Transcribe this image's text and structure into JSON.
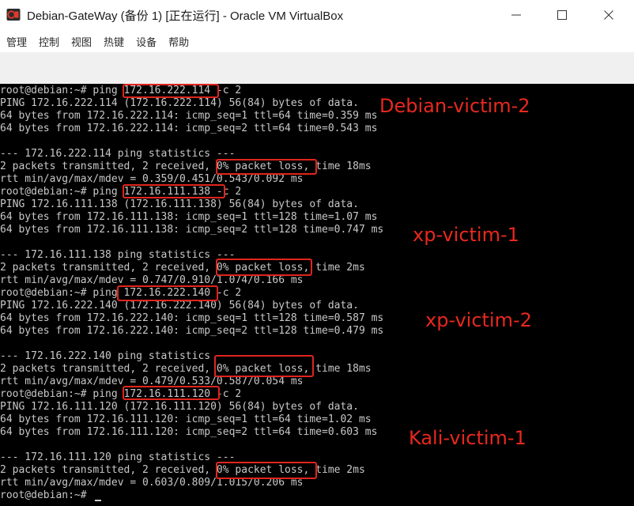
{
  "window": {
    "title": "Debian-GateWay (备份 1) [正在运行] - Oracle VM VirtualBox",
    "controls": {
      "minimize": "minimize",
      "maximize": "maximize",
      "close": "close"
    }
  },
  "menubar": {
    "items": [
      "管理",
      "控制",
      "视图",
      "热键",
      "设备",
      "帮助"
    ]
  },
  "terminal": {
    "lines": [
      "root@debian:~# ping 172.16.222.114 -c 2",
      "PING 172.16.222.114 (172.16.222.114) 56(84) bytes of data.",
      "64 bytes from 172.16.222.114: icmp_seq=1 ttl=64 time=0.359 ms",
      "64 bytes from 172.16.222.114: icmp_seq=2 ttl=64 time=0.543 ms",
      "",
      "--- 172.16.222.114 ping statistics ---",
      "2 packets transmitted, 2 received, 0% packet loss, time 18ms",
      "rtt min/avg/max/mdev = 0.359/0.451/0.543/0.092 ms",
      "root@debian:~# ping 172.16.111.138 -c 2",
      "PING 172.16.111.138 (172.16.111.138) 56(84) bytes of data.",
      "64 bytes from 172.16.111.138: icmp_seq=1 ttl=128 time=1.07 ms",
      "64 bytes from 172.16.111.138: icmp_seq=2 ttl=128 time=0.747 ms",
      "",
      "--- 172.16.111.138 ping statistics ---",
      "2 packets transmitted, 2 received, 0% packet loss, time 2ms",
      "rtt min/avg/max/mdev = 0.747/0.910/1.074/0.166 ms",
      "root@debian:~# ping 172.16.222.140 -c 2",
      "PING 172.16.222.140 (172.16.222.140) 56(84) bytes of data.",
      "64 bytes from 172.16.222.140: icmp_seq=1 ttl=128 time=0.587 ms",
      "64 bytes from 172.16.222.140: icmp_seq=2 ttl=128 time=0.479 ms",
      "",
      "--- 172.16.222.140 ping statistics ---",
      "2 packets transmitted, 2 received, 0% packet loss, time 18ms",
      "rtt min/avg/max/mdev = 0.479/0.533/0.587/0.054 ms",
      "root@debian:~# ping 172.16.111.120 -c 2",
      "PING 172.16.111.120 (172.16.111.120) 56(84) bytes of data.",
      "64 bytes from 172.16.111.120: icmp_seq=1 ttl=64 time=1.02 ms",
      "64 bytes from 172.16.111.120: icmp_seq=2 ttl=64 time=0.603 ms",
      "",
      "--- 172.16.111.120 ping statistics ---",
      "2 packets transmitted, 2 received, 0% packet loss, time 2ms",
      "rtt min/avg/max/mdev = 0.603/0.809/1.015/0.206 ms",
      "root@debian:~# "
    ],
    "text_color": "#c8c8c8",
    "background": "#000000"
  },
  "annotations": {
    "labels": [
      "Debian-victim-2",
      "xp-victim-1",
      "xp-victim-2",
      "Kali-victim-1"
    ],
    "color": "#e8281e"
  }
}
